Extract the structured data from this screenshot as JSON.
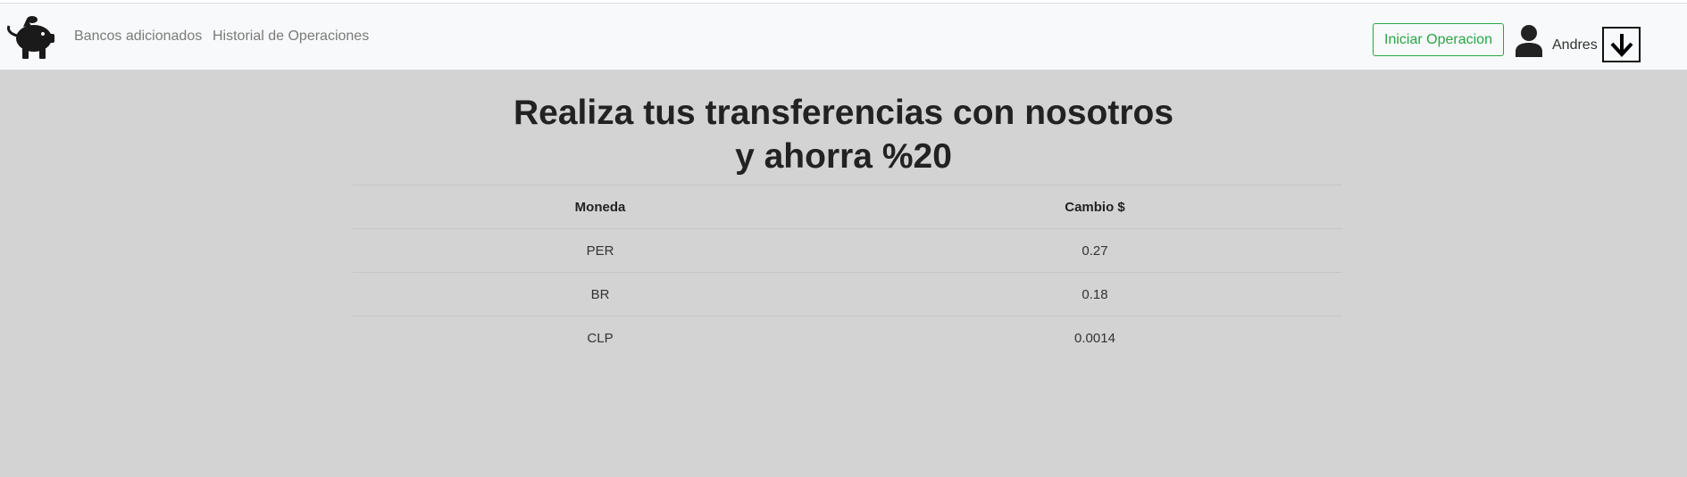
{
  "navbar": {
    "brand_icon": "piggy-bank-icon",
    "links": {
      "bancos": "Bancos adicionados",
      "historial": "Historial de Operaciones"
    },
    "start_button": "Iniciar Operacion",
    "user_icon": "user-icon",
    "user_name": "Andres",
    "dropdown_icon": "arrow-down-icon",
    "accent_color": "#28a745"
  },
  "hero": {
    "title_line1": "Realiza tus transferencias con nosotros",
    "title_line2": "y ahorra %20"
  },
  "table": {
    "headers": [
      "Moneda",
      "Cambio $"
    ],
    "rows": [
      [
        "PER",
        "0.27"
      ],
      [
        "BR",
        "0.18"
      ],
      [
        "CLP",
        "0.0014"
      ]
    ]
  }
}
